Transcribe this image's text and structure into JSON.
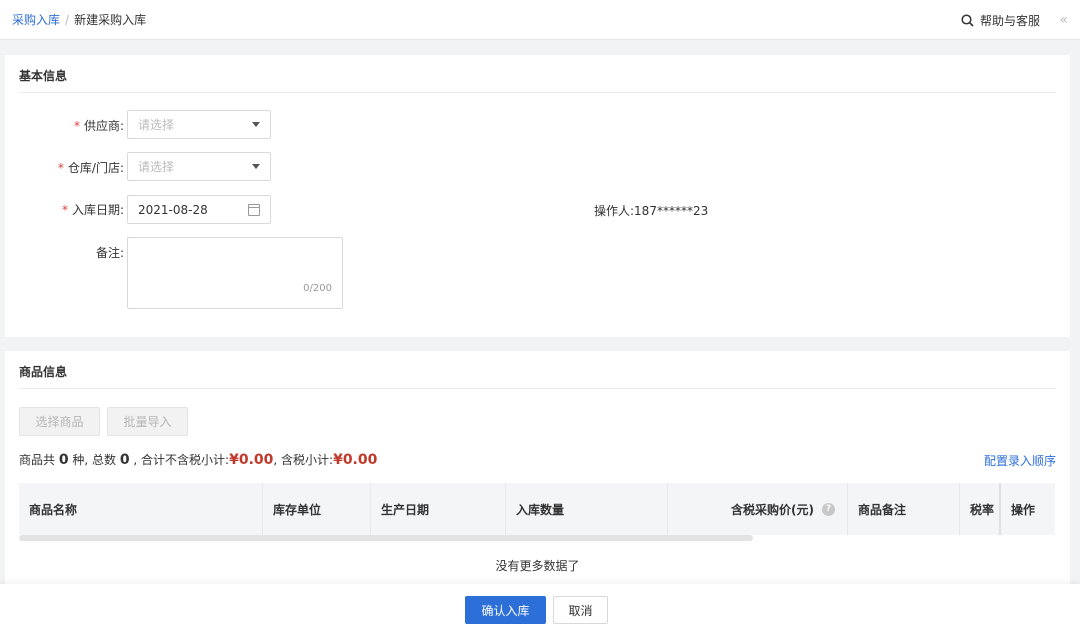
{
  "breadcrumb": {
    "parent": "采购入库",
    "separator": "/",
    "current": "新建采购入库"
  },
  "header": {
    "help_label": "帮助与客服",
    "collapse_glyph": "«"
  },
  "basic_info": {
    "title": "基本信息",
    "supplier": {
      "label": "供应商:",
      "placeholder": "请选择"
    },
    "warehouse": {
      "label": "仓库/门店:",
      "placeholder": "请选择"
    },
    "date": {
      "label": "入库日期:",
      "value": "2021-08-28"
    },
    "note": {
      "label": "备注:",
      "counter": "0/200"
    },
    "operator": "操作人:187******23",
    "required_mark": "*"
  },
  "goods_info": {
    "title": "商品信息",
    "select_button": "选择商品",
    "import_button": "批量导入",
    "summary": {
      "p1": "商品共 ",
      "kinds": "0",
      "p2": " 种,  总数 ",
      "total": "0",
      "p3": " ,  合计不含税小计:",
      "subtotal_ex_tax": "¥0.00",
      "p4": ",  含税小计:",
      "subtotal_tax": "¥0.00"
    },
    "config_link": "配置录入顺序",
    "columns": [
      "商品名称",
      "库存单位",
      "生产日期",
      "入库数量",
      "含税采购价(元)",
      "商品备注",
      "税率",
      "操作"
    ],
    "help_glyph": "?",
    "empty_text": "没有更多数据了"
  },
  "footer": {
    "submit_label": "确认入库",
    "cancel_label": "取消"
  },
  "colors": {
    "accent": "#2d6fd8",
    "required": "#e23b3b",
    "money": "#c0392b"
  }
}
